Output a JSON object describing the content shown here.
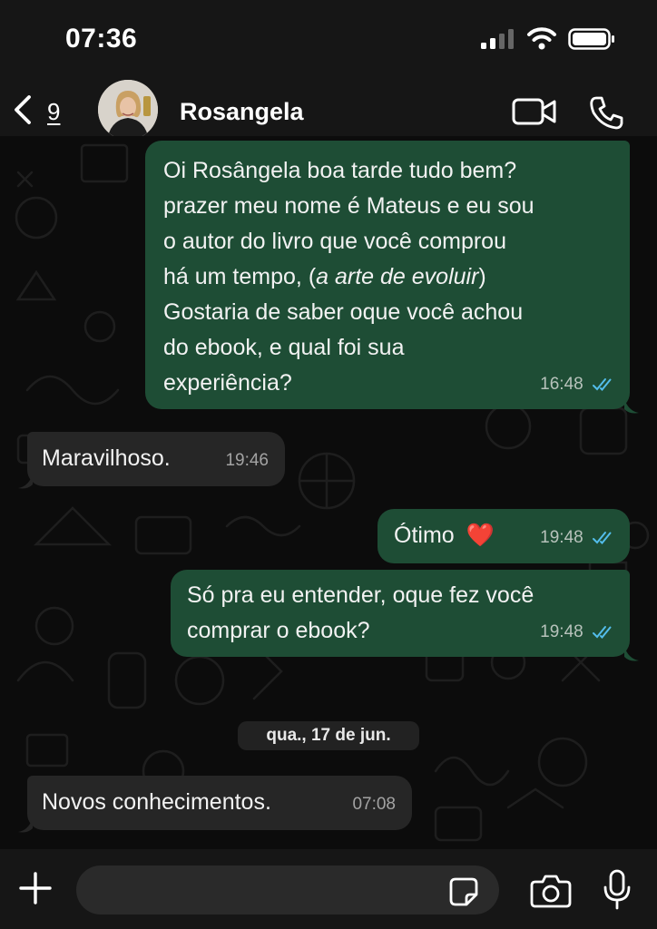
{
  "status_bar": {
    "time": "07:36"
  },
  "header": {
    "back_count": "9",
    "contact_name": "Rosangela"
  },
  "messages": [
    {
      "direction": "outgoing",
      "lines": [
        "Oi Rosângela boa tarde tudo bem?",
        "prazer meu nome é Mateus e eu sou",
        "o autor do livro que você comprou",
        "há um tempo, ",
        "a arte de evoluir",
        "Gostaria de saber oque você achou",
        "do ebook, e qual foi sua",
        "experiência?"
      ],
      "time": "16:48"
    },
    {
      "direction": "incoming",
      "text": "Maravilhoso.",
      "time": "19:46"
    },
    {
      "direction": "outgoing",
      "text": "Ótimo",
      "emoji": "❤️",
      "time": "19:48"
    },
    {
      "direction": "outgoing",
      "lines": [
        "Só pra eu entender, oque fez você",
        "comprar o ebook?"
      ],
      "time": "19:48"
    },
    {
      "direction": "incoming",
      "text": "Novos conhecimentos.",
      "time": "07:08"
    }
  ],
  "date_separator": "qua., 17 de jun.",
  "icons": {
    "back": "chevron-left-icon",
    "video": "video-camera-icon",
    "phone": "phone-icon",
    "plus": "plus-icon",
    "sticker": "sticker-icon",
    "camera": "camera-icon",
    "mic": "microphone-icon",
    "read_receipt": "double-check-icon"
  },
  "colors": {
    "outgoing_bubble": "#1e4d35",
    "incoming_bubble": "#262626",
    "read_ticks": "#53bdeb",
    "background": "#0c0c0c"
  }
}
